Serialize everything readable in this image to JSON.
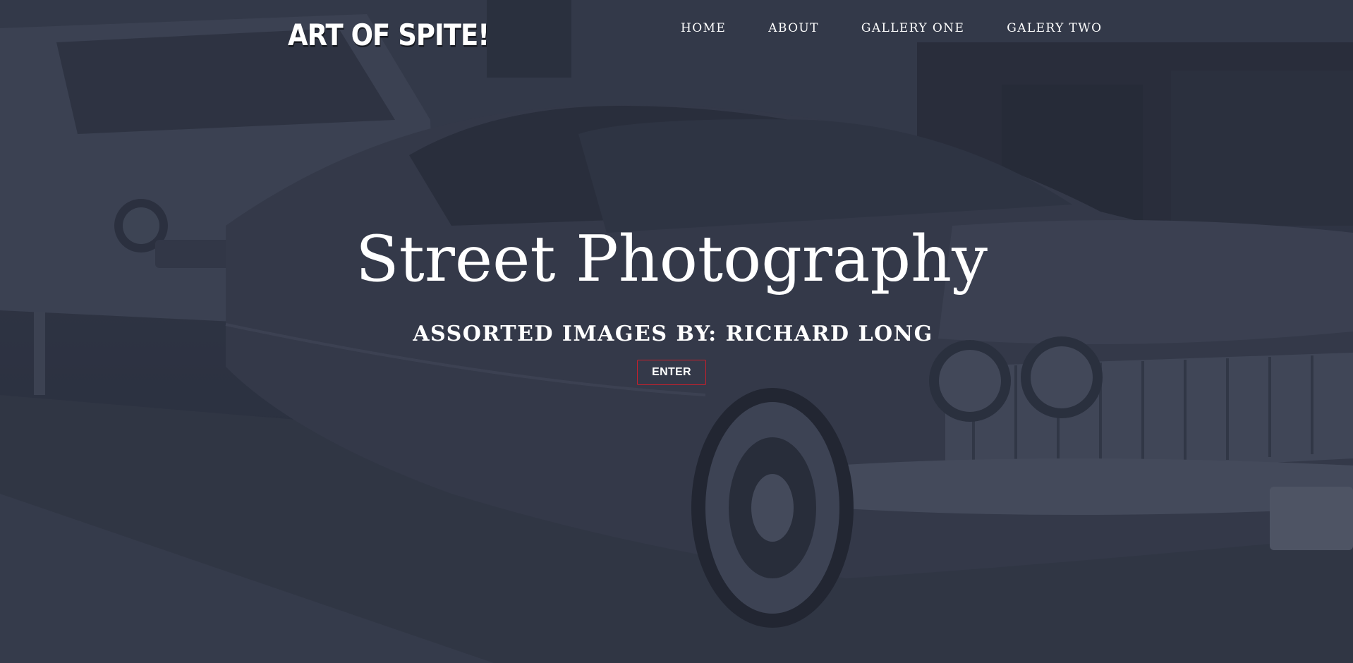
{
  "header": {
    "logo_text": "ART OF SPITE!",
    "nav": [
      {
        "label": "HOME"
      },
      {
        "label": "ABOUT"
      },
      {
        "label": "GALLERY ONE"
      },
      {
        "label": "GALERY TWO"
      }
    ]
  },
  "hero": {
    "title": "Street Photography",
    "subtitle": "ASSORTED IMAGES BY: RICHARD LONG",
    "cta_label": "ENTER",
    "background_image": "vintage-car-street-photo"
  },
  "colors": {
    "overlay": "#2f3544",
    "text": "#ffffff",
    "cta_border": "#c8202c"
  }
}
